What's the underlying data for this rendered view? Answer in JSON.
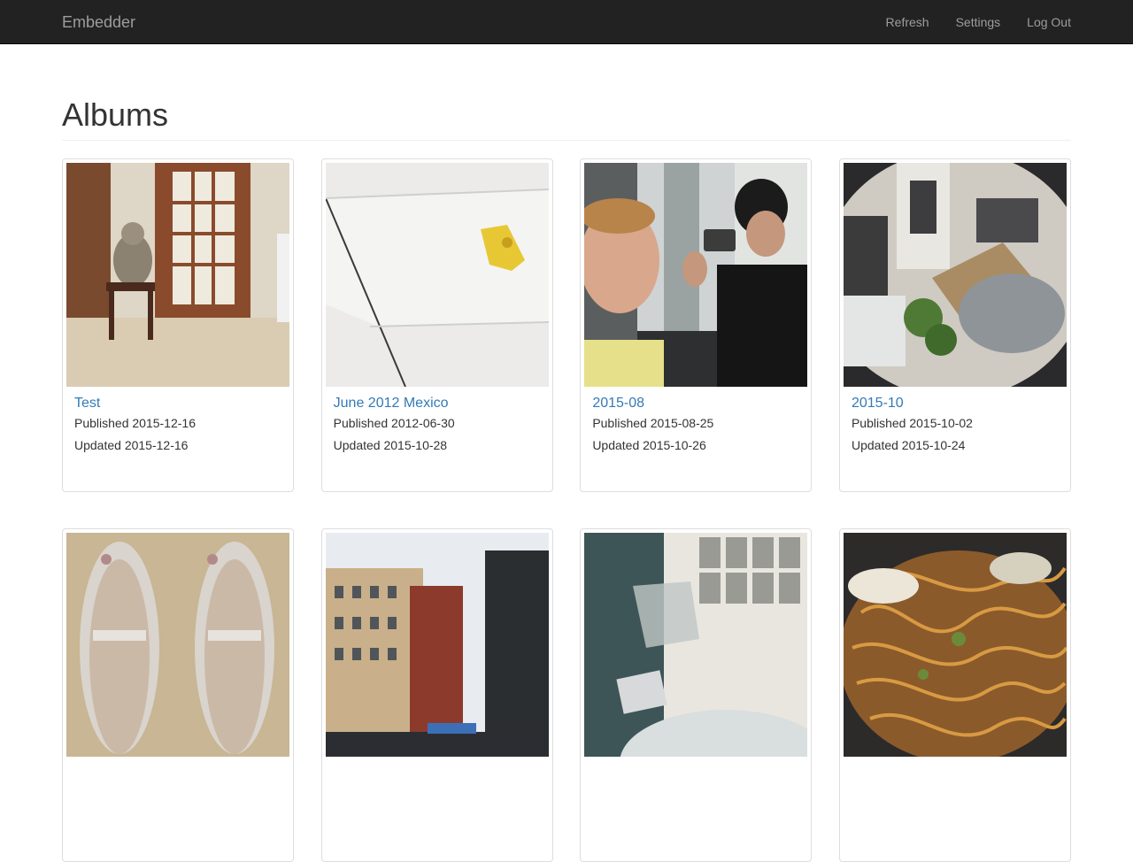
{
  "navbar": {
    "brand": "Embedder",
    "links": [
      "Refresh",
      "Settings",
      "Log Out"
    ]
  },
  "page": {
    "title": "Albums"
  },
  "albums": [
    {
      "title": "Test",
      "published": "Published 2015-12-16",
      "updated": "Updated 2015-12-16"
    },
    {
      "title": "June 2012 Mexico",
      "published": "Published 2012-06-30",
      "updated": "Updated 2015-10-28"
    },
    {
      "title": "2015-08",
      "published": "Published 2015-08-25",
      "updated": "Updated 2015-10-26"
    },
    {
      "title": "2015-10",
      "published": "Published 2015-10-02",
      "updated": "Updated 2015-10-24"
    },
    {
      "title": "",
      "published": "",
      "updated": ""
    },
    {
      "title": "",
      "published": "",
      "updated": ""
    },
    {
      "title": "",
      "published": "",
      "updated": ""
    },
    {
      "title": "",
      "published": "",
      "updated": ""
    }
  ]
}
